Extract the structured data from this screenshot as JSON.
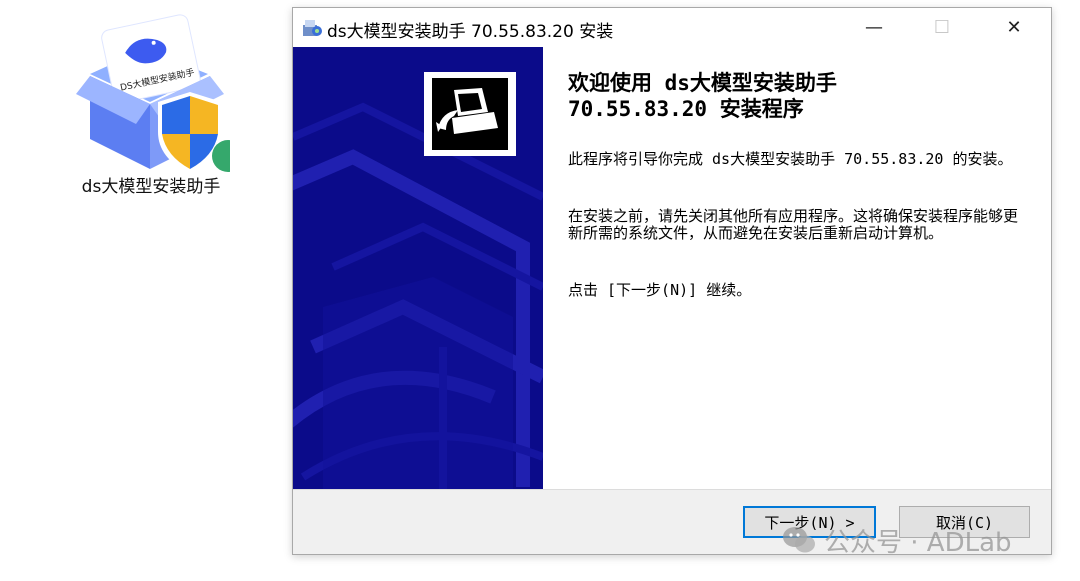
{
  "desktop": {
    "icon_label": "ds大模型安装助手",
    "box_text": "DS大模型安装助手"
  },
  "window": {
    "title": "ds大模型安装助手 70.55.83.20 安装",
    "controls": {
      "minimize": "—",
      "maximize": "☐",
      "close": "✕"
    }
  },
  "wizard": {
    "heading_line1": "欢迎使用 ds大模型安装助手",
    "heading_line2": "70.55.83.20 安装程序",
    "para1": "此程序将引导你完成 ds大模型安装助手 70.55.83.20 的安装。",
    "para2": "在安装之前，请先关闭其他所有应用程序。这将确保安装程序能够更新所需的系统文件，从而避免在安装后重新启动计算机。",
    "para3": "点击 [下一步(N)] 继续。"
  },
  "buttons": {
    "next": "下一步(N) >",
    "cancel": "取消(C)"
  },
  "watermark": "公众号 · ADLab",
  "colors": {
    "banner": "#0b0b8a",
    "banner_pattern": "#1a1aa8",
    "focus_border": "#0078d7"
  }
}
